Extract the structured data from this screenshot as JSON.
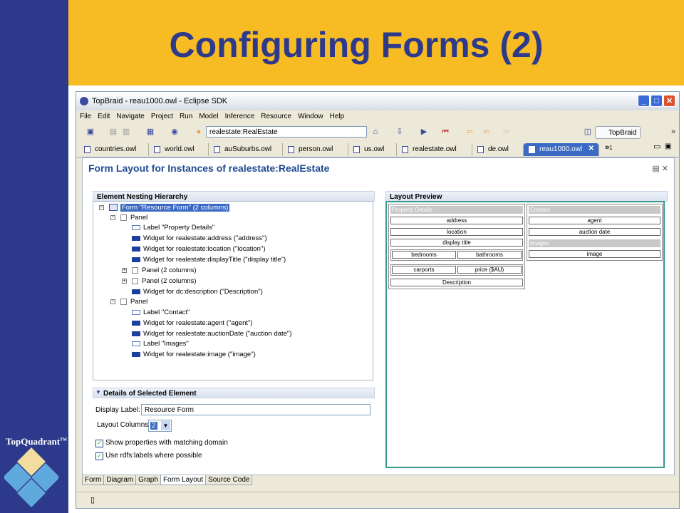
{
  "slide": {
    "title": "Configuring Forms (2)",
    "brand": "TopQuadrant",
    "brand_tm": "TM",
    "colors": {
      "band_blue": "#2d3a8c",
      "band_gold": "#f7bb23"
    }
  },
  "window": {
    "title": "TopBraid - reau1000.owl - Eclipse SDK",
    "menu": [
      "File",
      "Edit",
      "Navigate",
      "Project",
      "Run",
      "Model",
      "Inference",
      "Resource",
      "Window",
      "Help"
    ],
    "resource_field": "realestate:RealEstate",
    "perspective_button": "TopBraid",
    "tabs": [
      "countries.owl",
      "world.owl",
      "auSuburbs.owl",
      "person.owl",
      "us.owl",
      "realestate.owl",
      "de.owl",
      "reau1000.owl"
    ],
    "overflow_count": "1"
  },
  "editor": {
    "heading": "Form Layout for Instances of realestate:RealEstate",
    "hierarchy_title": "Element Nesting Hierarchy",
    "preview_title": "Layout Preview",
    "tree": [
      {
        "text": "Form \"Resource Form\" (2 columns)",
        "icon": "form"
      },
      {
        "text": "Panel",
        "icon": "panel"
      },
      {
        "text": "Label \"Property Details\"",
        "icon": "label"
      },
      {
        "text": "Widget for realestate:address (\"address\")",
        "icon": "widget"
      },
      {
        "text": "Widget for realestate:location (\"location\")",
        "icon": "widget"
      },
      {
        "text": "Widget for realestate:displayTitle (\"display title\")",
        "icon": "widget"
      },
      {
        "text": "Panel (2 columns)",
        "icon": "panel"
      },
      {
        "text": "Panel (2 columns)",
        "icon": "panel"
      },
      {
        "text": "Widget for dc:description (\"Description\")",
        "icon": "widget"
      },
      {
        "text": "Panel",
        "icon": "panel"
      },
      {
        "text": "Label \"Contact\"",
        "icon": "label"
      },
      {
        "text": "Widget for realestate:agent (\"agent\")",
        "icon": "widget"
      },
      {
        "text": "Widget for realestate:auctionDate (\"auction date\")",
        "icon": "widget"
      },
      {
        "text": "Label \"Images\"",
        "icon": "label"
      },
      {
        "text": "Widget for realestate:image (\"image\")",
        "icon": "widget"
      }
    ],
    "details": {
      "title": "Details of Selected Element",
      "display_label_caption": "Display Label:",
      "display_label_value": "Resource Form",
      "layout_columns_caption": "Layout Columns:",
      "layout_columns_value": "2",
      "checkbox_domain": "Show properties with matching domain",
      "checkbox_labels": "Use rdfs:labels where possible"
    },
    "preview": {
      "left_head": "Property Details",
      "address": "address",
      "location": "location",
      "display_title": "display title",
      "bedrooms": "bedrooms",
      "bathrooms": "bathrooms",
      "carports": "carports",
      "price": "price ($AU)",
      "description": "Description",
      "right_head": "Contact",
      "agent": "agent",
      "auction_date": "auction date",
      "images_head": "Images",
      "image": "image"
    }
  },
  "bottom_tabs": [
    "Form",
    "Diagram",
    "Graph",
    "Form Layout",
    "Source Code"
  ]
}
